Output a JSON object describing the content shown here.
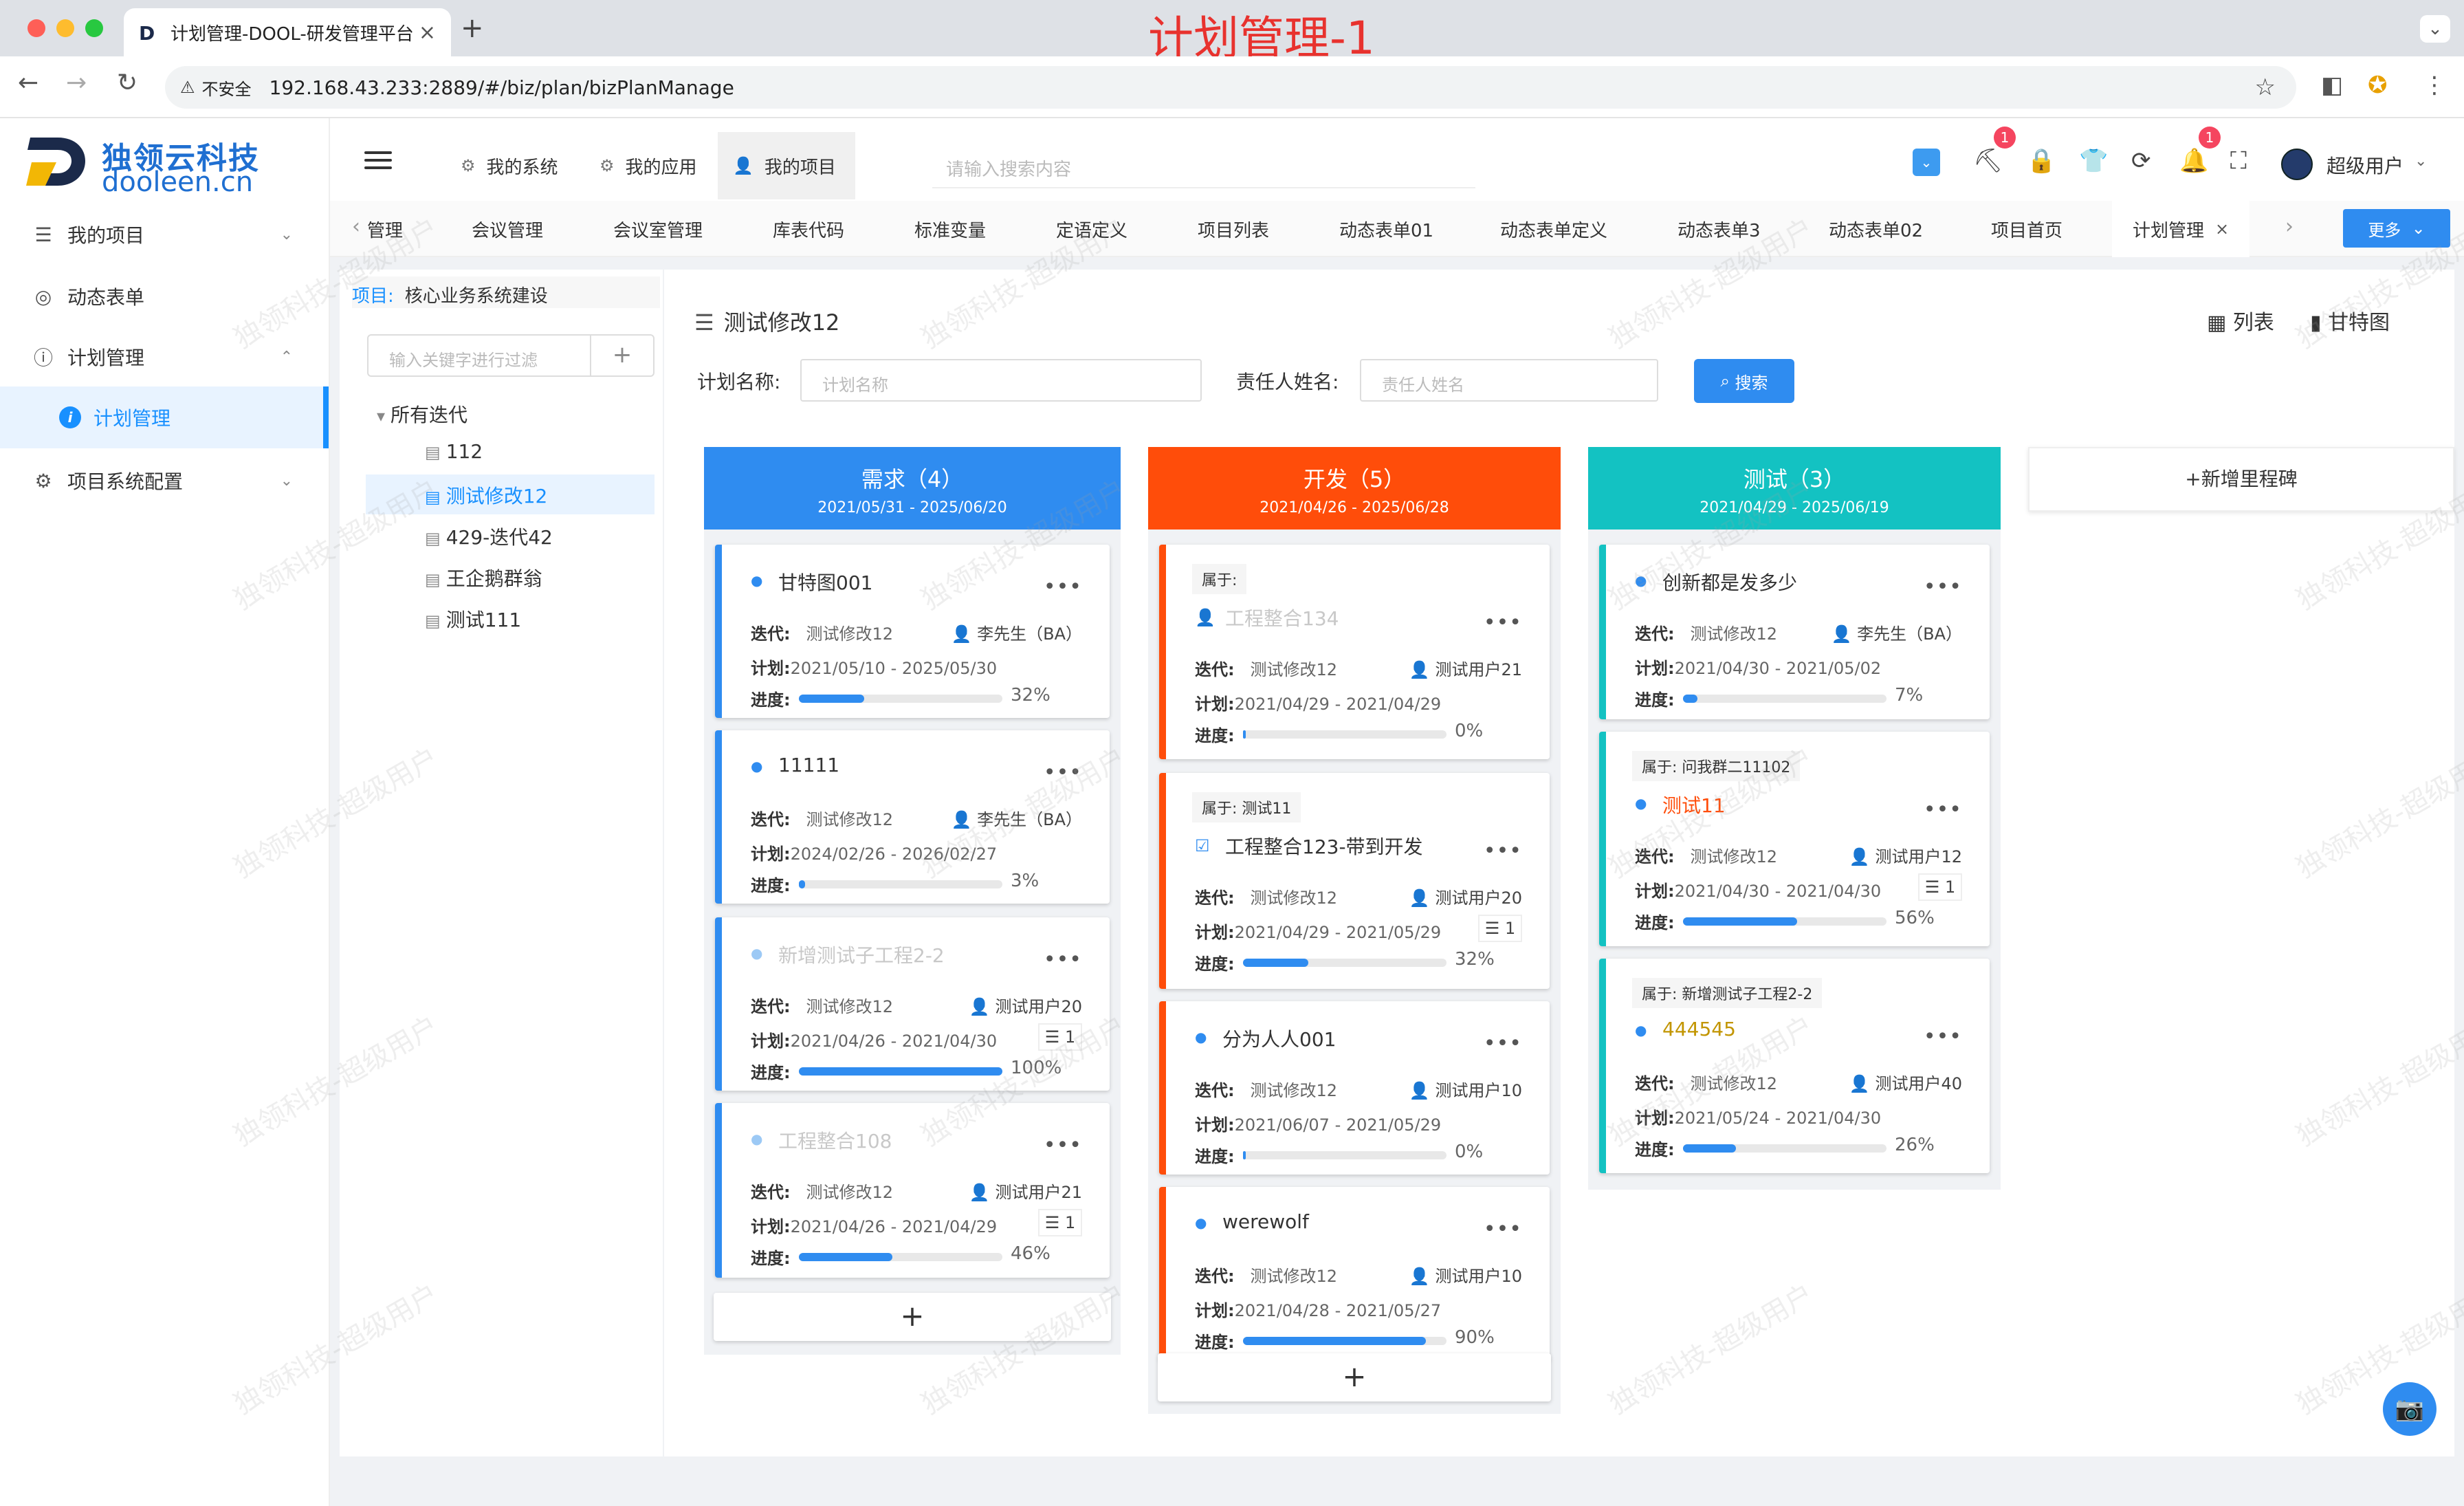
{
  "browser": {
    "tab_title": "计划管理-DOOL-研发管理平台",
    "screenshot_caption": "计划管理-1",
    "insecure_label": "不安全",
    "url": "192.168.43.233:2889/#/biz/plan/bizPlanManage"
  },
  "logo": {
    "cn": "独领云科技",
    "en": "dooleen.cn"
  },
  "sidebar": {
    "items": [
      {
        "label": "我的项目",
        "icon": "sliders-icon"
      },
      {
        "label": "动态表单",
        "icon": "lifebuoy-icon"
      },
      {
        "label": "计划管理",
        "icon": "info-icon"
      },
      {
        "label": "项目系统配置",
        "icon": "gear-icon"
      }
    ],
    "active_sub": "计划管理"
  },
  "header": {
    "tabs": [
      {
        "label": "我的系统"
      },
      {
        "label": "我的应用"
      },
      {
        "label": "我的项目"
      }
    ],
    "search_placeholder": "请输入搜索内容",
    "badge1": "1",
    "badge2": "1",
    "user": "超级用户"
  },
  "tags": {
    "items": [
      "管理",
      "会议管理",
      "会议室管理",
      "库表代码",
      "标准变量",
      "定语定义",
      "项目列表",
      "动态表单01",
      "动态表单定义",
      "动态表单3",
      "动态表单02",
      "项目首页",
      "计划管理"
    ],
    "more": "更多"
  },
  "tree": {
    "project_label": "项目:",
    "project_name": "核心业务系统建设",
    "filter_placeholder": "输入关键字进行过滤",
    "root": "所有迭代",
    "nodes": [
      "112",
      "测试修改12",
      "429-迭代42",
      "王企鹅群翁",
      "测试111"
    ]
  },
  "main": {
    "title": "测试修改12",
    "view_list": "列表",
    "view_gantt": "甘特图",
    "plan_name_label": "计划名称:",
    "plan_name_placeholder": "计划名称",
    "owner_label": "责任人姓名:",
    "owner_placeholder": "责任人姓名",
    "search_btn": "搜索",
    "add_milestone": "+新增里程碑"
  },
  "labels": {
    "iter": "迭代:",
    "plan": "计划:",
    "progress": "进度:",
    "belong": "属于:"
  },
  "columns": [
    {
      "title": "需求（4）",
      "range": "2021/05/31 - 2025/06/20",
      "color": "#2f8cf0",
      "cards": [
        {
          "title": "甘特图001",
          "iter": "测试修改12",
          "owner": "李先生（BA）",
          "plan": "2021/05/10 - 2025/05/30",
          "progress": 32,
          "pct": "32%"
        },
        {
          "title": "11111",
          "iter": "测试修改12",
          "owner": "李先生（BA）",
          "plan": "2024/02/26 - 2026/02/27",
          "progress": 3,
          "pct": "3%"
        },
        {
          "title": "新增测试子工程2-2",
          "iter": "测试修改12",
          "owner": "测试用户20",
          "plan": "2021/04/26 - 2021/04/30",
          "sub": "1",
          "progress": 100,
          "pct": "100%"
        },
        {
          "title": "工程整合108",
          "iter": "测试修改12",
          "owner": "测试用户21",
          "plan": "2021/04/26 - 2021/04/29",
          "sub": "1",
          "progress": 46,
          "pct": "46%"
        }
      ]
    },
    {
      "title": "开发（5）",
      "range": "2021/04/26 - 2025/06/28",
      "color": "#ff4d0a",
      "cards": [
        {
          "belong": "",
          "title": "工程整合134",
          "iter": "测试修改12",
          "owner": "测试用户21",
          "plan": "2021/04/29 - 2021/04/29",
          "progress": 0,
          "pct": "0%"
        },
        {
          "belong": "测试11",
          "title": "工程整合123-带到开发",
          "iter": "测试修改12",
          "owner": "测试用户20",
          "plan": "2021/04/29 - 2021/05/29",
          "sub": "1",
          "progress": 32,
          "pct": "32%"
        },
        {
          "title": "分为人人001",
          "iter": "测试修改12",
          "owner": "测试用户10",
          "plan": "2021/06/07 - 2021/05/29",
          "progress": 0,
          "pct": "0%"
        },
        {
          "title": "werewolf",
          "iter": "测试修改12",
          "owner": "测试用户10",
          "plan": "2021/04/28 - 2021/05/27",
          "progress": 90,
          "pct": "90%"
        }
      ]
    },
    {
      "title": "测试（3）",
      "range": "2021/04/29 - 2025/06/19",
      "color": "#13c2c2",
      "cards": [
        {
          "title": "创新都是发多少",
          "iter": "测试修改12",
          "owner": "李先生（BA）",
          "plan": "2021/04/30 - 2021/05/02",
          "progress": 7,
          "pct": "7%"
        },
        {
          "belong": "问我群二11102",
          "title": "测试11",
          "iter": "测试修改12",
          "owner": "测试用户12",
          "plan": "2021/04/30 - 2021/04/30",
          "sub": "1",
          "progress": 56,
          "pct": "56%"
        },
        {
          "belong": "新增测试子工程2-2",
          "title": "444545",
          "iter": "测试修改12",
          "owner": "测试用户40",
          "plan": "2021/05/24 - 2021/04/30",
          "progress": 26,
          "pct": "26%"
        }
      ]
    }
  ],
  "watermark": "独领科技-超级用户",
  "colors": {
    "primary": "#2f8cf0",
    "orange": "#ff4d0a",
    "teal": "#13c2c2",
    "title_red": "#e8322e"
  }
}
